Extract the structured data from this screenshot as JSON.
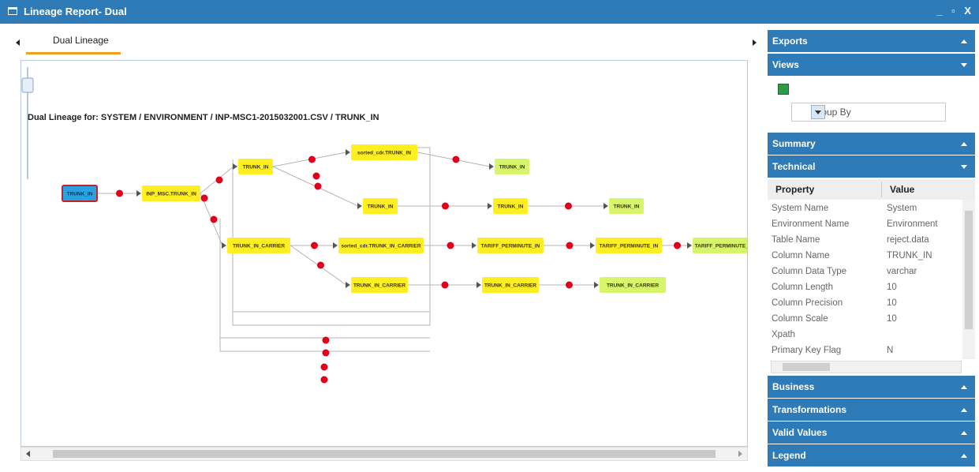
{
  "window": {
    "title": "Lineage Report- Dual",
    "controls": "_ ▫ X"
  },
  "tabs": [
    {
      "label": "Dual Lineage"
    }
  ],
  "graph": {
    "heading": "Dual Lineage for: SYSTEM / ENVIRONMENT / INP-MSC1-2015032001.CSV / TRUNK_IN",
    "nodes": [
      {
        "id": "n0",
        "label": "TRUNK_IN",
        "kind": "source"
      },
      {
        "id": "n1",
        "label": "INP_MSC.TRUNK_IN",
        "kind": "intermediate"
      },
      {
        "id": "n2",
        "label": "TRUNK_IN",
        "kind": "intermediate"
      },
      {
        "id": "n3",
        "label": "sorted_cdr.TRUNK_IN",
        "kind": "intermediate"
      },
      {
        "id": "n4",
        "label": "TRUNK_IN",
        "kind": "target"
      },
      {
        "id": "n5",
        "label": "TRUNK_IN",
        "kind": "intermediate"
      },
      {
        "id": "n6",
        "label": "TRUNK_IN",
        "kind": "intermediate"
      },
      {
        "id": "n7",
        "label": "TRUNK_IN",
        "kind": "target"
      },
      {
        "id": "n8",
        "label": "TRUNK_IN_CARRIER",
        "kind": "intermediate"
      },
      {
        "id": "n9",
        "label": "sorted_cdr.TRUNK_IN_CARRIER",
        "kind": "intermediate"
      },
      {
        "id": "n10",
        "label": "TARIFF_PERMINUTE_IN",
        "kind": "intermediate"
      },
      {
        "id": "n11",
        "label": "TARIFF_PERMINUTE_IN",
        "kind": "intermediate"
      },
      {
        "id": "n12",
        "label": "TARIFF_PERMINUTE_IN",
        "kind": "target"
      },
      {
        "id": "n13",
        "label": "TRUNK_IN_CARRIER",
        "kind": "intermediate"
      },
      {
        "id": "n14",
        "label": "TRUNK_IN_CARRIER",
        "kind": "intermediate"
      },
      {
        "id": "n15",
        "label": "TRUNK_IN_CARRIER",
        "kind": "target"
      }
    ],
    "edges": [
      {
        "from": "n0",
        "to": "n1"
      },
      {
        "from": "n1",
        "to": "n2"
      },
      {
        "from": "n1",
        "to": "n8"
      },
      {
        "from": "n2",
        "to": "n3"
      },
      {
        "from": "n2",
        "to": "n5"
      },
      {
        "from": "n3",
        "to": "n4"
      },
      {
        "from": "n5",
        "to": "n6"
      },
      {
        "from": "n6",
        "to": "n7"
      },
      {
        "from": "n8",
        "to": "n9"
      },
      {
        "from": "n8",
        "to": "n13"
      },
      {
        "from": "n9",
        "to": "n10"
      },
      {
        "from": "n10",
        "to": "n11"
      },
      {
        "from": "n11",
        "to": "n12"
      },
      {
        "from": "n13",
        "to": "n14"
      },
      {
        "from": "n14",
        "to": "n15"
      }
    ],
    "colors": {
      "source": "#29a3e0",
      "intermediate": "#ffee22",
      "target": "#d6f56a",
      "marker": "#e0001a",
      "edge": "#b4b4b4"
    }
  },
  "sidebar": {
    "sections": {
      "exports": "Exports",
      "views": "Views",
      "summary": "Summary",
      "technical": "Technical",
      "business": "Business",
      "transformations": "Transformations",
      "valid_values": "Valid Values",
      "legend": "Legend"
    },
    "views": {
      "icon": "grid-icon",
      "group_by": "Group By"
    },
    "technical": {
      "columns": [
        "Property",
        "Value"
      ],
      "rows": [
        {
          "property": "System Name",
          "value": "System"
        },
        {
          "property": "Environment Name",
          "value": "Environment"
        },
        {
          "property": "Table Name",
          "value": "reject.data"
        },
        {
          "property": "Column Name",
          "value": "TRUNK_IN"
        },
        {
          "property": "Column Data Type",
          "value": "varchar"
        },
        {
          "property": "Column Length",
          "value": "10"
        },
        {
          "property": "Column Precision",
          "value": "10"
        },
        {
          "property": "Column Scale",
          "value": "10"
        },
        {
          "property": "Xpath",
          "value": ""
        },
        {
          "property": "Primary Key Flag",
          "value": "N"
        }
      ]
    }
  },
  "colors": {
    "header": "#2e7bb8",
    "tab_underline": "#f0a020"
  }
}
